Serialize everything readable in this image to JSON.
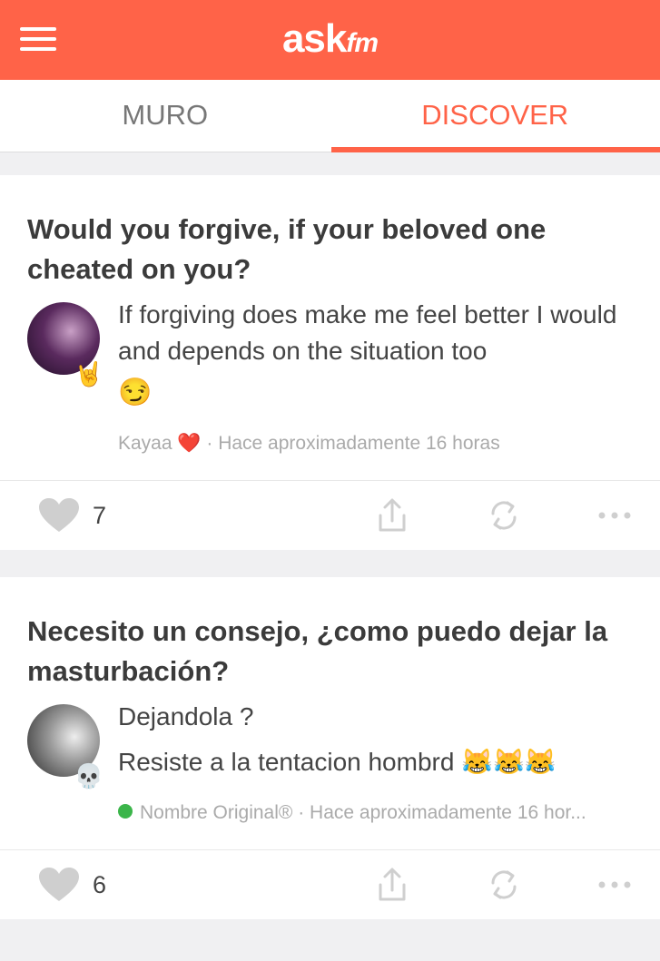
{
  "header": {
    "logo_main": "ask",
    "logo_fm": "fm",
    "menu_icon": "hamburger-icon",
    "brand_color": "#ff6348"
  },
  "tabs": [
    {
      "label": "MURO",
      "active": false
    },
    {
      "label": "DISCOVER",
      "active": true
    }
  ],
  "posts": [
    {
      "question": "Would you forgive, if your beloved one cheated on you?",
      "answer_line1": "If forgiving does make me feel better I would and depends on the situation too",
      "answer_line2": "😏",
      "avatar_badge": "🤘",
      "author": "Kayaa ❤️",
      "time": "· Hace aproximadamente 16 horas",
      "likes": "7"
    },
    {
      "question": "Necesito un consejo, ¿como puedo dejar la masturbación?",
      "answer_line1": "Dejandola ?",
      "answer_line2": "Resiste a la tentacion hombrd 😹😹😹",
      "avatar_badge": "💀",
      "author": "Nombre Original®",
      "time": "· Hace aproximadamente 16 hor...",
      "likes": "6",
      "online": true
    }
  ]
}
